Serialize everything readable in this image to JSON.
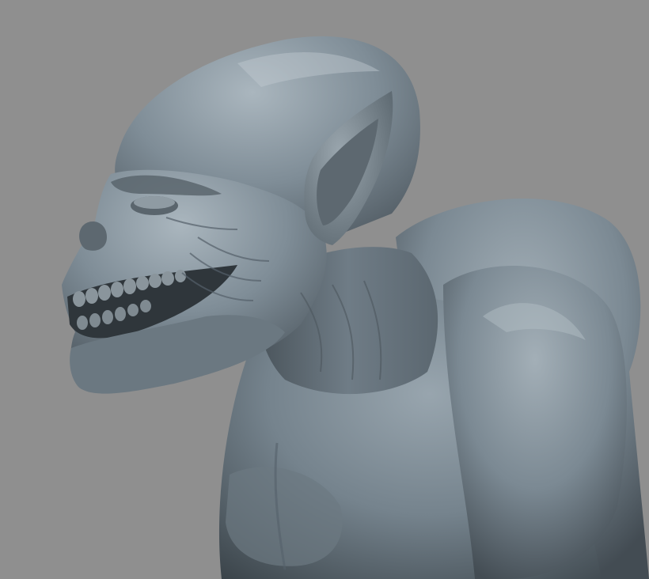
{
  "viewport": {
    "subject": "sculpted-creature-bust",
    "background_color": "#8f8f8f",
    "material_color": "#7d8b95"
  }
}
